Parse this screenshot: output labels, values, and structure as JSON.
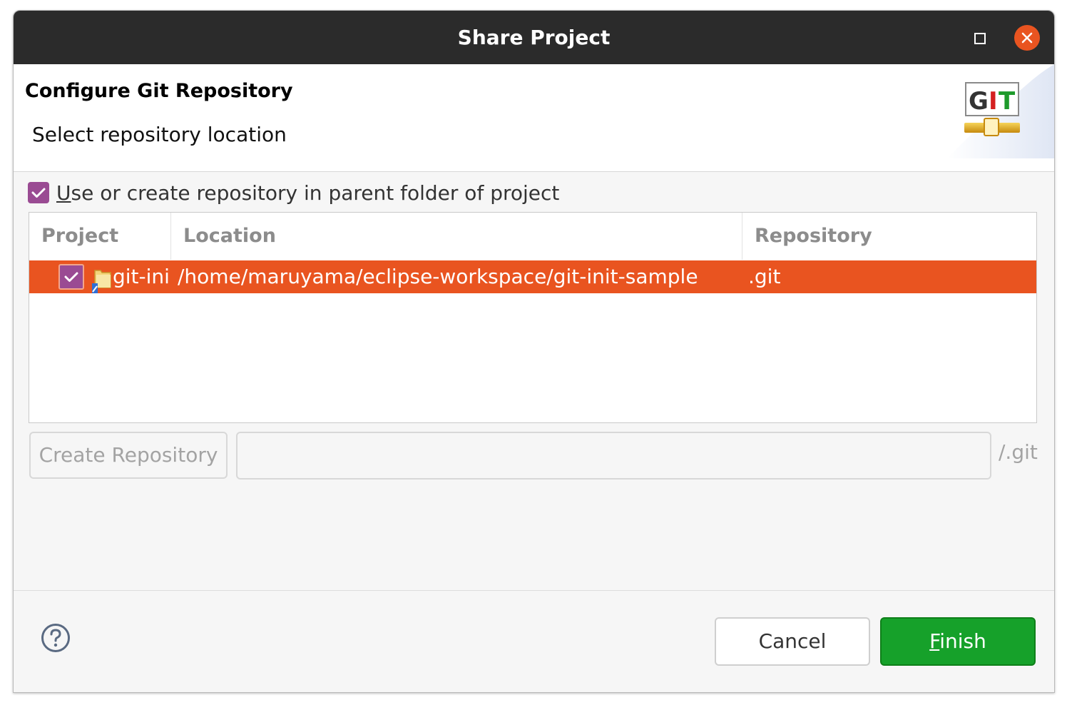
{
  "window": {
    "title": "Share Project",
    "maximize_icon": "maximize-icon",
    "close_icon": "close-icon",
    "accent_color": "#e95420"
  },
  "banner": {
    "heading": "Configure Git Repository",
    "subheading": "Select repository location",
    "logo_text": "GIT",
    "logo_letters": [
      "G",
      "I",
      "T"
    ]
  },
  "use_parent": {
    "checked": true,
    "label_mnemonic": "U",
    "label_rest": "se or create repository in parent folder of project"
  },
  "table": {
    "columns": [
      "Project",
      "Location",
      "Repository"
    ],
    "rows": [
      {
        "checked": true,
        "project": "git-init",
        "location": "/home/maruyama/eclipse-workspace/git-init-sample",
        "repository": ".git",
        "selected": true
      }
    ]
  },
  "create_repository": {
    "button_label": "Create Repository",
    "input_value": "",
    "suffix": "/.git"
  },
  "footer": {
    "help_icon": "help-icon",
    "cancel_label": "Cancel",
    "finish_mnemonic": "F",
    "finish_rest": "inish",
    "finish_color": "#16a12a"
  }
}
